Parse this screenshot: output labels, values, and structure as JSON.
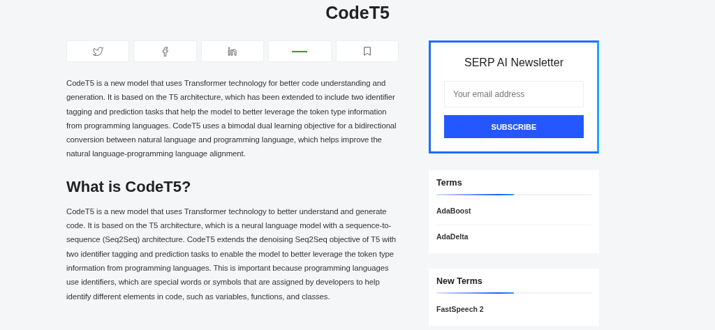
{
  "page_title": "CodeT5",
  "share_buttons": [
    {
      "kind": "twitter"
    },
    {
      "kind": "facebook"
    },
    {
      "kind": "linkedin"
    },
    {
      "kind": "line"
    },
    {
      "kind": "bookmark"
    }
  ],
  "intro": "CodeT5 is a new model that uses Transformer technology for better code understanding and generation. It is based on the T5 architecture, which has been extended to include two identifier tagging and prediction tasks that help the model to better leverage the token type information from programming languages. CodeT5 uses a bimodal dual learning objective for a bidirectional conversion between natural language and programming language, which helps improve the natural language-programming language alignment.",
  "section": {
    "heading": "What is CodeT5?",
    "body": "CodeT5 is a new model that uses Transformer technology to better understand and generate code. It is based on the T5 architecture, which is a neural language model with a sequence-to-sequence (Seq2Seq) architecture. CodeT5 extends the denoising Seq2Seq objective of T5 with two identifier tagging and prediction tasks to enable the model to better leverage the token type information from programming languages. This is important because programming languages use identifiers, which are special words or symbols that are assigned by developers to help identify different elements in code, such as variables, functions, and classes."
  },
  "newsletter": {
    "title": "SERP AI Newsletter",
    "placeholder": "Your email address",
    "button": "SUBSCRIBE"
  },
  "widgets": [
    {
      "title": "Terms",
      "items": [
        "AdaBoost",
        "AdaDelta"
      ]
    },
    {
      "title": "New Terms",
      "items": [
        "FastSpeech 2"
      ]
    }
  ]
}
